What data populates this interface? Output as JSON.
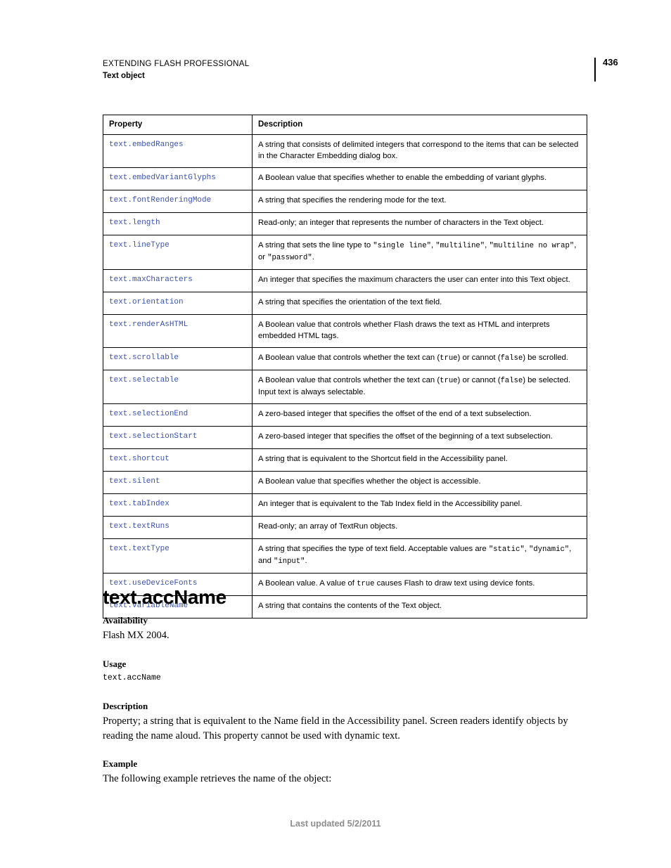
{
  "header": {
    "product_line": "EXTENDING FLASH PROFESSIONAL",
    "section": "Text object",
    "page_number": "436"
  },
  "table": {
    "columns": [
      "Property",
      "Description"
    ],
    "rows": [
      {
        "property": "text.embedRanges",
        "description": "A string that consists of delimited integers that correspond to the items that can be selected in the Character Embedding dialog box."
      },
      {
        "property": "text.embedVariantGlyphs",
        "description": "A Boolean value that specifies whether to enable the embedding of variant glyphs."
      },
      {
        "property": "text.fontRenderingMode",
        "description": "A string that specifies the rendering mode for the text."
      },
      {
        "property": "text.length",
        "description": "Read-only; an integer that represents the number of characters in the Text object."
      },
      {
        "property": "text.lineType",
        "description_parts": [
          {
            "t": "text",
            "v": "A string that sets the line type to "
          },
          {
            "t": "code",
            "v": "\"single line\""
          },
          {
            "t": "text",
            "v": ", "
          },
          {
            "t": "code",
            "v": "\"multiline\""
          },
          {
            "t": "text",
            "v": ", "
          },
          {
            "t": "code",
            "v": "\"multiline no wrap\""
          },
          {
            "t": "text",
            "v": ", or "
          },
          {
            "t": "code",
            "v": "\"password\""
          },
          {
            "t": "text",
            "v": "."
          }
        ]
      },
      {
        "property": "text.maxCharacters",
        "description": "An integer that specifies the maximum characters the user can enter into this Text object."
      },
      {
        "property": "text.orientation",
        "description": "A string that specifies the orientation of the text field."
      },
      {
        "property": "text.renderAsHTML",
        "description": "A Boolean value that controls whether Flash draws the text as HTML and interprets embedded HTML tags."
      },
      {
        "property": "text.scrollable",
        "description_parts": [
          {
            "t": "text",
            "v": "A Boolean value that controls whether the text can ("
          },
          {
            "t": "code",
            "v": "true"
          },
          {
            "t": "text",
            "v": ") or cannot ("
          },
          {
            "t": "code",
            "v": "false"
          },
          {
            "t": "text",
            "v": ") be scrolled."
          }
        ]
      },
      {
        "property": "text.selectable",
        "description_parts": [
          {
            "t": "text",
            "v": "A Boolean value that controls whether the text can ("
          },
          {
            "t": "code",
            "v": "true"
          },
          {
            "t": "text",
            "v": ") or cannot ("
          },
          {
            "t": "code",
            "v": "false"
          },
          {
            "t": "text",
            "v": ") be selected. Input text is always selectable."
          }
        ]
      },
      {
        "property": "text.selectionEnd",
        "description": "A zero-based integer that specifies the offset of the end of a text subselection."
      },
      {
        "property": "text.selectionStart",
        "description": "A zero-based integer that specifies the offset of the beginning of a text subselection."
      },
      {
        "property": "text.shortcut",
        "description": "A string that is equivalent to the Shortcut field in the Accessibility panel."
      },
      {
        "property": "text.silent",
        "description": "A Boolean value that specifies whether the object is accessible."
      },
      {
        "property": "text.tabIndex",
        "description": "An integer that is equivalent to the Tab Index field in the Accessibility panel."
      },
      {
        "property": "text.textRuns",
        "description": "Read-only; an array of TextRun objects."
      },
      {
        "property": "text.textType",
        "description_parts": [
          {
            "t": "text",
            "v": "A string that specifies the type of text field. Acceptable values are "
          },
          {
            "t": "code",
            "v": "\"static\""
          },
          {
            "t": "text",
            "v": ", "
          },
          {
            "t": "code",
            "v": "\"dynamic\""
          },
          {
            "t": "text",
            "v": ", and "
          },
          {
            "t": "code",
            "v": "\"input\""
          },
          {
            "t": "text",
            "v": "."
          }
        ]
      },
      {
        "property": "text.useDeviceFonts",
        "description_parts": [
          {
            "t": "text",
            "v": "A Boolean value. A value of "
          },
          {
            "t": "code",
            "v": "true"
          },
          {
            "t": "text",
            "v": " causes Flash to draw text using device fonts."
          }
        ]
      },
      {
        "property": "text.variableName",
        "description": "A string that contains the contents of the Text object."
      }
    ]
  },
  "section": {
    "title": "text.accName",
    "availability": {
      "heading": "Availability",
      "body": "Flash MX 2004."
    },
    "usage": {
      "heading": "Usage",
      "code": "text.accName"
    },
    "description": {
      "heading": "Description",
      "body": "Property; a string that is equivalent to the Name field in the Accessibility panel. Screen readers identify objects by reading the name aloud. This property cannot be used with dynamic text."
    },
    "example": {
      "heading": "Example",
      "body": "The following example retrieves the name of the object:"
    }
  },
  "footer": {
    "text": "Last updated 5/2/2011"
  },
  "colors": {
    "link_blue": "#3b53b0",
    "footer_gray": "#8d8d8d",
    "rule_black": "#000000"
  }
}
